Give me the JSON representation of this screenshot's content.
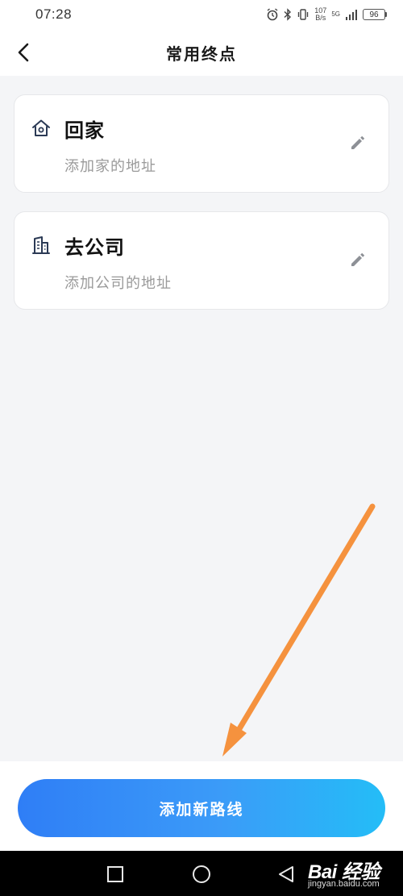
{
  "status_bar": {
    "time": "07:28",
    "net_speed_value": "107",
    "net_speed_unit": "B/s",
    "signal_label": "5G",
    "battery_level": "96",
    "icons": [
      "alarm-icon",
      "bluetooth-icon",
      "vibrate-icon",
      "signal-icon",
      "battery-icon"
    ]
  },
  "header": {
    "title": "常用终点",
    "back_icon": "chevron-left-icon"
  },
  "destinations": [
    {
      "title": "回家",
      "subtitle": "添加家的地址",
      "icon": "home-icon",
      "edit_icon": "pencil-icon"
    },
    {
      "title": "去公司",
      "subtitle": "添加公司的地址",
      "icon": "building-icon",
      "edit_icon": "pencil-icon"
    }
  ],
  "add_route": {
    "label": "添加新路线"
  },
  "nav": {
    "icons": [
      "recent-apps-icon",
      "home-circle-icon",
      "back-triangle-icon"
    ]
  },
  "watermark": {
    "main": "Bai 经验",
    "sub": "jingyan.baidu.com"
  },
  "colors": {
    "background": "#f4f5f7",
    "card": "#ffffff",
    "button_gradient_start": "#2f7ef6",
    "button_gradient_end": "#24bdf7",
    "annotation_arrow": "#f5923e"
  }
}
